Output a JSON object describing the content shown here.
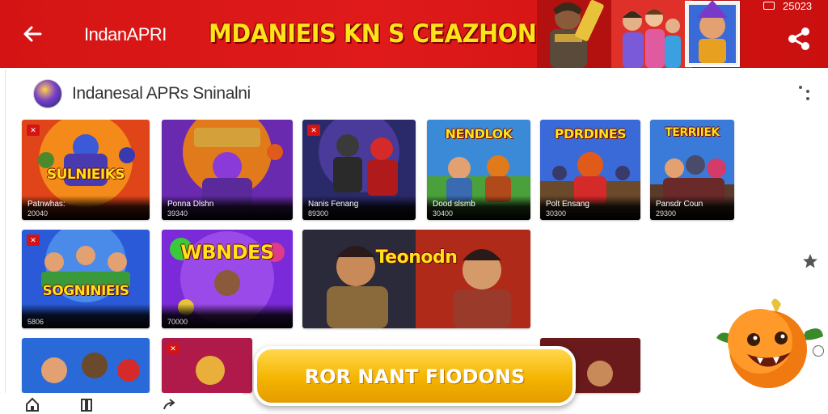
{
  "header": {
    "app_name": "IndanAPRI",
    "headline": "MDANIEIS KN S CEAZHON",
    "status_time": "25023",
    "colors": {
      "bar": "#d41414",
      "headline": "#ffe21a"
    }
  },
  "section": {
    "title": "Indanesal APRs Sninalni"
  },
  "tiles": [
    {
      "title": "SULNIEIKS",
      "name": "Patnwhas:",
      "sub": "20040"
    },
    {
      "title": "",
      "name": "Ponna Dlshn",
      "sub": "39340"
    },
    {
      "title": "",
      "name": "Nanis Fenang",
      "sub": "89300"
    },
    {
      "title": "NENDLOK",
      "name": "Dood slsmb",
      "sub": "30400"
    },
    {
      "title": "PDRDINES",
      "name": "Polt Ensang",
      "sub": "30300"
    },
    {
      "title": "TERRIIEK",
      "name": "Pansdr Coun",
      "sub": "29300"
    },
    {
      "title": "SOGNINIEIS",
      "name": "",
      "sub": "5806"
    },
    {
      "title": "WBNDES",
      "name": "",
      "sub": "70000"
    },
    {
      "title": "Teonodn",
      "name": "",
      "sub": ""
    }
  ],
  "cta": {
    "label": "ROR NANT FIODONS"
  },
  "icons": {
    "back": "arrow-left-icon",
    "share": "share-icon",
    "more": "more-dots-icon",
    "star": "star-icon",
    "circle": "circle-icon",
    "nav": [
      "home-icon",
      "library-icon",
      "forward-icon"
    ]
  }
}
